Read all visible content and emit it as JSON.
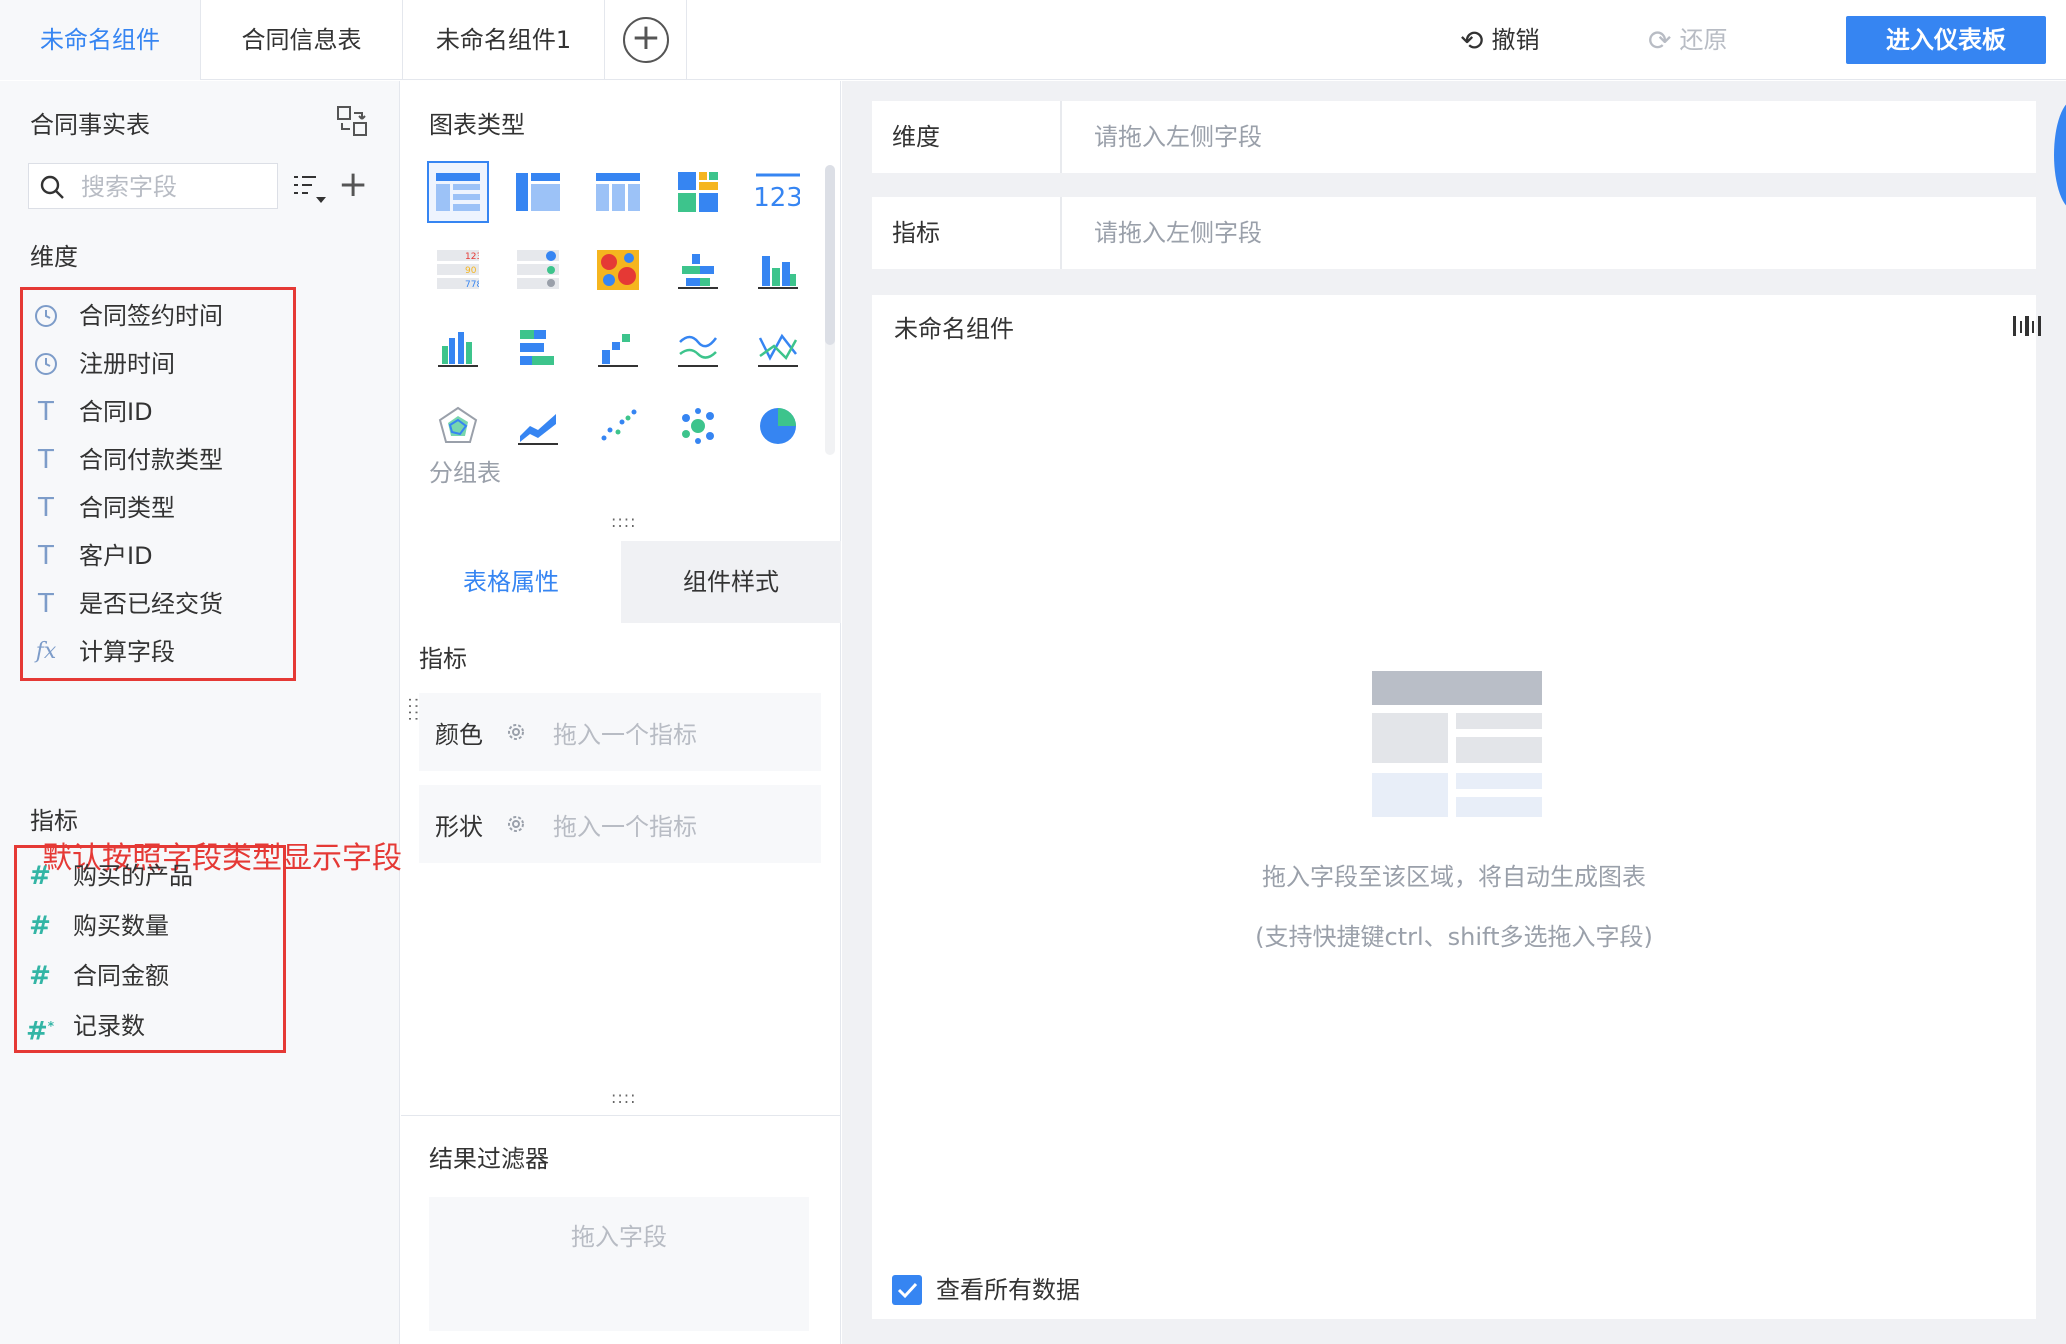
{
  "tabs": [
    {
      "label": "未命名组件",
      "active": true
    },
    {
      "label": "合同信息表",
      "active": false
    },
    {
      "label": "未命名组件1",
      "active": false
    }
  ],
  "toolbar": {
    "undo_label": "撤销",
    "redo_label": "还原",
    "dashboard_label": "进入仪表板"
  },
  "left_panel": {
    "dataset_title": "合同事实表",
    "search_placeholder": "搜索字段",
    "dimension_label": "维度",
    "dimensions": [
      {
        "type": "date",
        "name": "合同签约时间"
      },
      {
        "type": "date",
        "name": "注册时间"
      },
      {
        "type": "text",
        "name": "合同ID"
      },
      {
        "type": "text",
        "name": "合同付款类型"
      },
      {
        "type": "text",
        "name": "合同类型"
      },
      {
        "type": "text",
        "name": "客户ID"
      },
      {
        "type": "text",
        "name": "是否已经交货"
      },
      {
        "type": "formula",
        "name": "计算字段"
      }
    ],
    "annotation": "默认按照字段类型显示字段顺序",
    "measure_label": "指标",
    "measures": [
      {
        "type": "number",
        "name": "购买的产品"
      },
      {
        "type": "number",
        "name": "购买数量"
      },
      {
        "type": "number",
        "name": "合同金额"
      },
      {
        "type": "count",
        "name": "记录数"
      }
    ]
  },
  "middle_panel": {
    "chart_type_title": "图表类型",
    "selected_chart_label": "分组表",
    "property_tabs": {
      "active": "表格属性",
      "inactive": "组件样式"
    },
    "measure_section": "指标",
    "color_label": "颜色",
    "color_value": "拖入一个指标",
    "shape_label": "形状",
    "shape_value": "拖入一个指标",
    "filter_title": "结果过滤器",
    "filter_placeholder": "拖入字段"
  },
  "right_panel": {
    "dimension_shelf_label": "维度",
    "dimension_shelf_placeholder": "请拖入左侧字段",
    "measure_shelf_label": "指标",
    "measure_shelf_placeholder": "请拖入左侧字段",
    "canvas_title": "未命名组件",
    "empty_hint_1": "拖入字段至该区域，将自动生成图表",
    "empty_hint_2": "(支持快捷键ctrl、shift多选拖入字段)",
    "view_all_data_label": "查看所有数据",
    "view_all_data_checked": true
  },
  "colors": {
    "accent": "#3685f2",
    "annotation_red": "#e53935",
    "measure_teal": "#33b5a5"
  }
}
